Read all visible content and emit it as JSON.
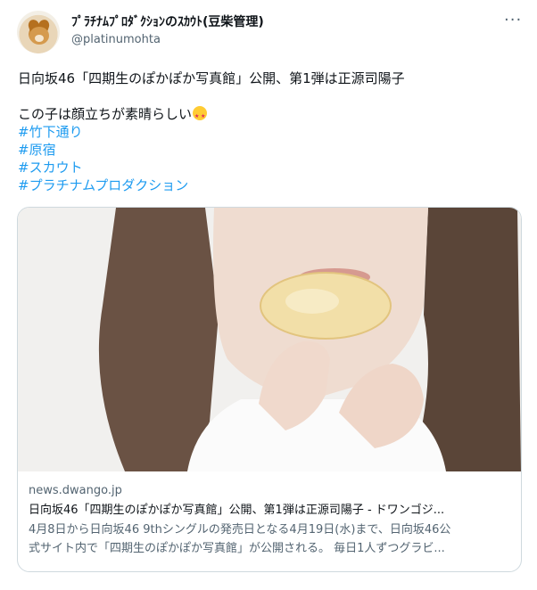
{
  "author": {
    "display_name": "ﾌﾟﾗﾁﾅﾑﾌﾟﾛﾀﾞｸｼｮﾝのｽｶｳﾄ(豆柴管理)",
    "handle": "@platinumohta"
  },
  "more_icon": "more-horizontal-icon",
  "tweet": {
    "line1": "日向坂46「四期生のぽかぽか写真館」公開、第1弾は正源司陽子",
    "line2": "この子は顔立ちが素晴らしい",
    "emoji": "star-struck-emoji",
    "hashtags": [
      "#竹下通り",
      "#原宿",
      "#スカウト",
      "#プラチナムプロダクション"
    ]
  },
  "card": {
    "domain": "news.dwango.jp",
    "title": "日向坂46「四期生のぽかぽか写真館」公開、第1弾は正源司陽子 - ドワンゴジ...",
    "desc_line1": "4月8日から日向坂46 9thシングルの発売日となる4月19日(水)まで、日向坂46公",
    "desc_line2": "式サイト内で「四期生のぽかぽか写真館」が公開される。 毎日1人ずつグラビ..."
  },
  "colors": {
    "hashtag": "#1d9bf0",
    "text": "#0f1419",
    "muted": "#536471",
    "border": "#cfd9de"
  }
}
